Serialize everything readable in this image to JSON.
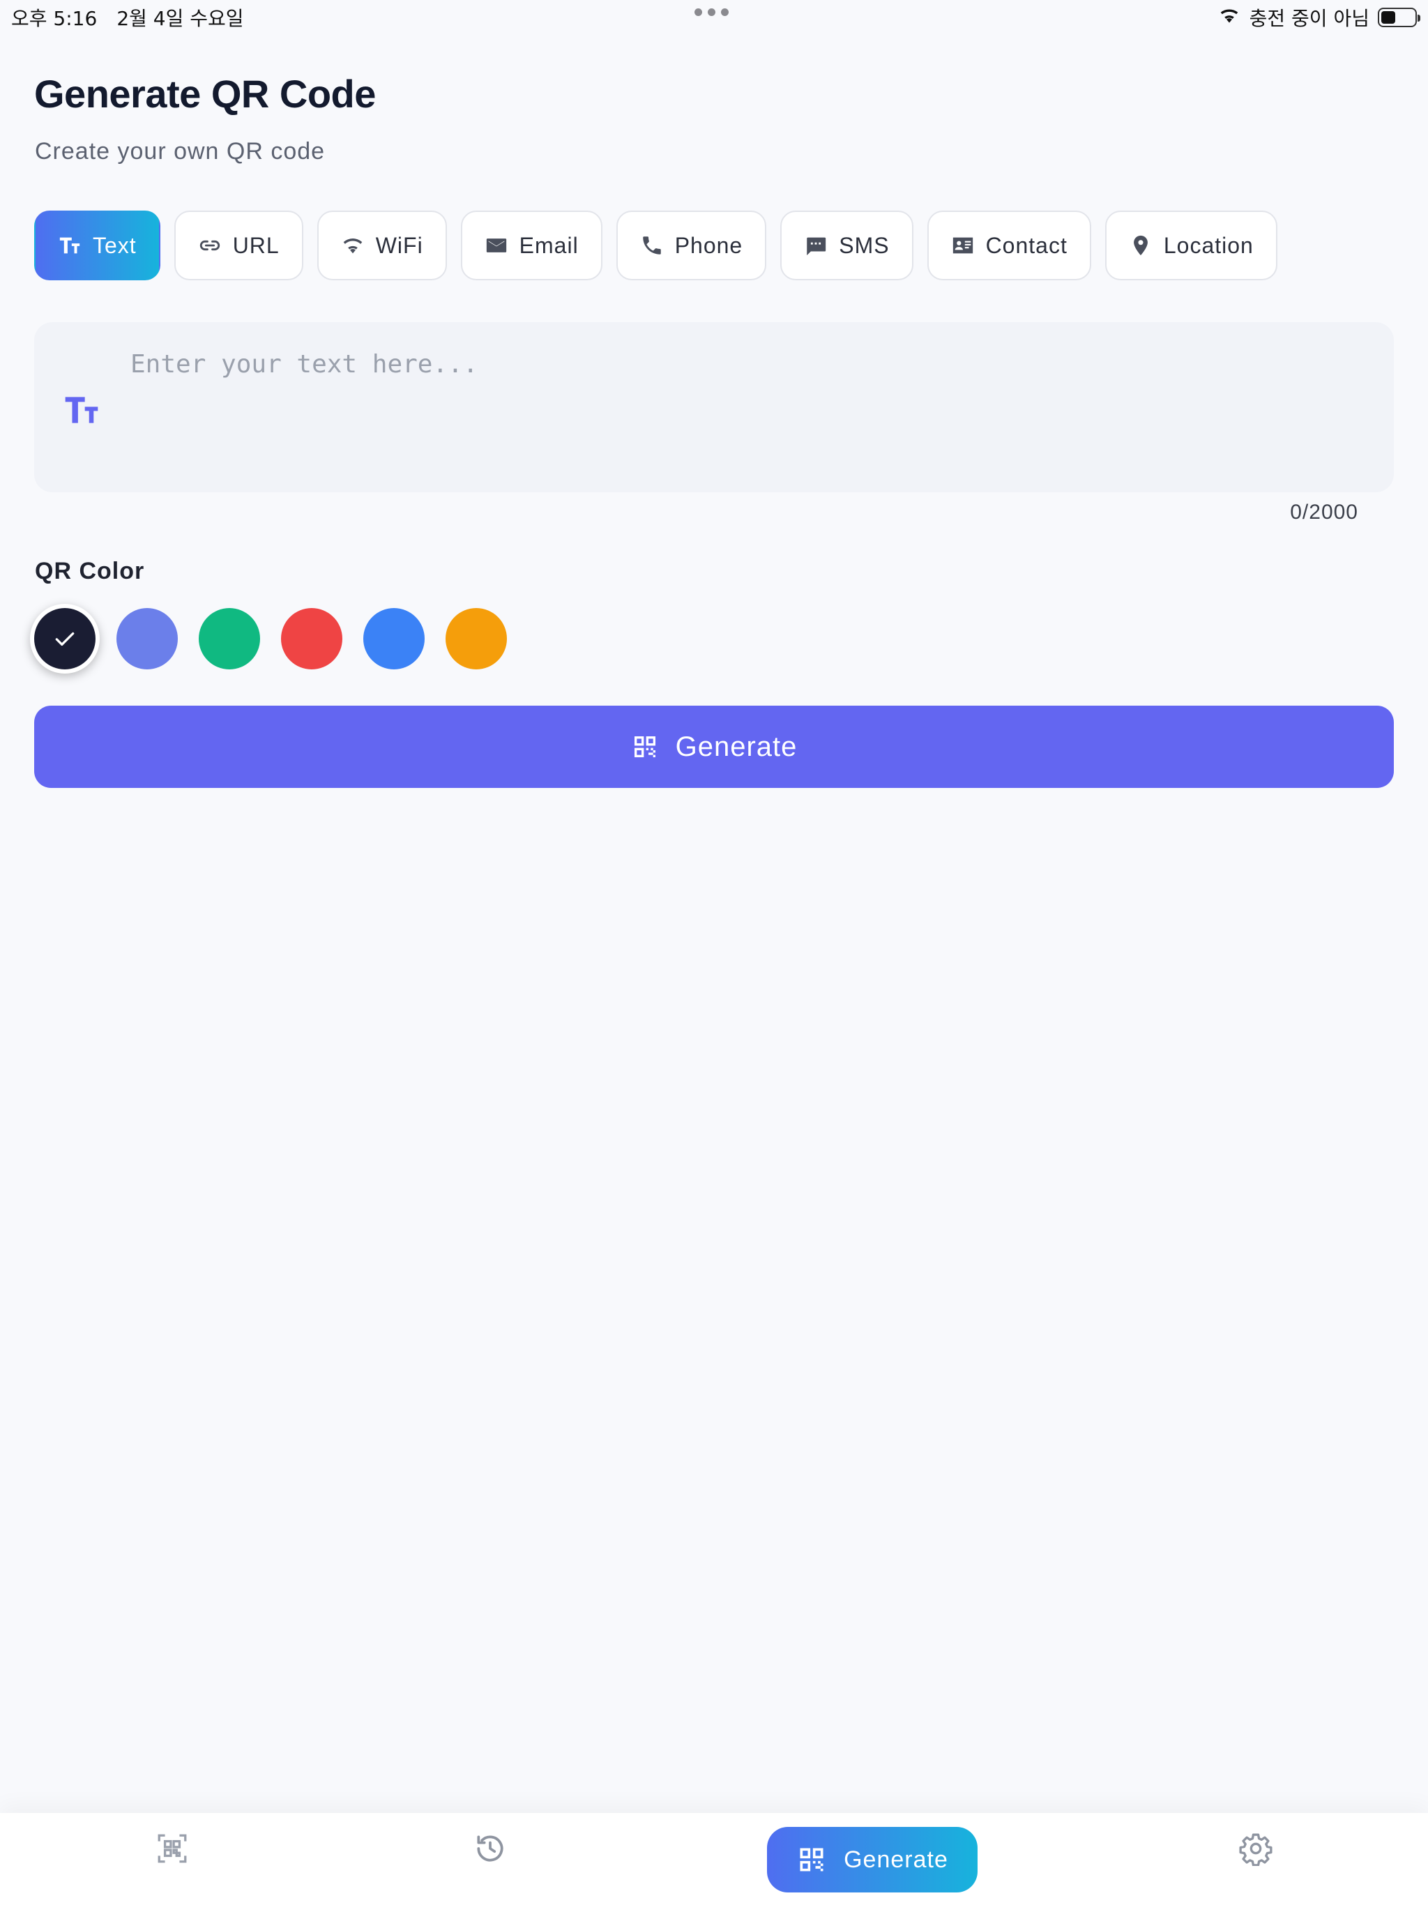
{
  "status_bar": {
    "time": "오후 5:16",
    "date": "2월 4일 수요일",
    "charging": "충전 중이 아님"
  },
  "header": {
    "title": "Generate QR Code",
    "subtitle": "Create your own QR code"
  },
  "types": [
    {
      "label": "Text",
      "icon": "text-size-icon",
      "active": true
    },
    {
      "label": "URL",
      "icon": "link-icon",
      "active": false
    },
    {
      "label": "WiFi",
      "icon": "wifi-icon",
      "active": false
    },
    {
      "label": "Email",
      "icon": "mail-icon",
      "active": false
    },
    {
      "label": "Phone",
      "icon": "phone-icon",
      "active": false
    },
    {
      "label": "SMS",
      "icon": "sms-icon",
      "active": false
    },
    {
      "label": "Contact",
      "icon": "contact-card-icon",
      "active": false
    },
    {
      "label": "Location",
      "icon": "location-pin-icon",
      "active": false
    }
  ],
  "text_input": {
    "value": "",
    "placeholder": "Enter your text here...",
    "char_count": "0/2000"
  },
  "qr_color": {
    "label": "QR Color",
    "options": [
      "#1a1d33",
      "#6b7fea",
      "#10b981",
      "#ef4444",
      "#3b82f6",
      "#f59e0b"
    ],
    "selected_index": 0
  },
  "generate_button": {
    "label": "Generate"
  },
  "bottom_nav": {
    "generate_label": "Generate"
  },
  "colors": {
    "accent": "#6366f1",
    "gradient_start": "#4f6ef0",
    "gradient_end": "#17b3dc"
  }
}
